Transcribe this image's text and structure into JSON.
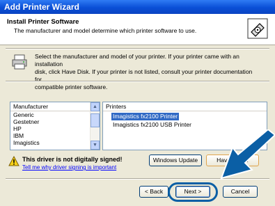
{
  "window": {
    "title": "Add Printer Wizard"
  },
  "header": {
    "title": "Install Printer Software",
    "subtitle": "The manufacturer and model determine which printer software to use."
  },
  "info": {
    "line1": "Select the manufacturer and model of your printer. If your printer came with an installation",
    "line2": "disk, click Have Disk. If your printer is not listed, consult your printer documentation for",
    "line3": "compatible printer software."
  },
  "manufacturers": {
    "header": "Manufacturer",
    "items": [
      "Generic",
      "Gestetner",
      "HP",
      "IBM",
      "Imagistics"
    ],
    "selected": "Imagistics"
  },
  "printers": {
    "header": "Printers",
    "items": [
      "Imagistics fx2100 Printer",
      "Imagistics fx2100 USB Printer"
    ],
    "selected": "Imagistics fx2100 Printer"
  },
  "driver": {
    "warning": "This driver is not digitally signed!",
    "link": "Tell me why driver signing is important"
  },
  "buttons": {
    "windows_update": "Windows Update",
    "have_disk": "Have Disk...",
    "back": "< Back",
    "next": "Next >",
    "cancel": "Cancel"
  },
  "colors": {
    "title_bar": "#0a4fd6",
    "selection": "#316ac5",
    "callout_arrow": "#0b5fa5"
  }
}
